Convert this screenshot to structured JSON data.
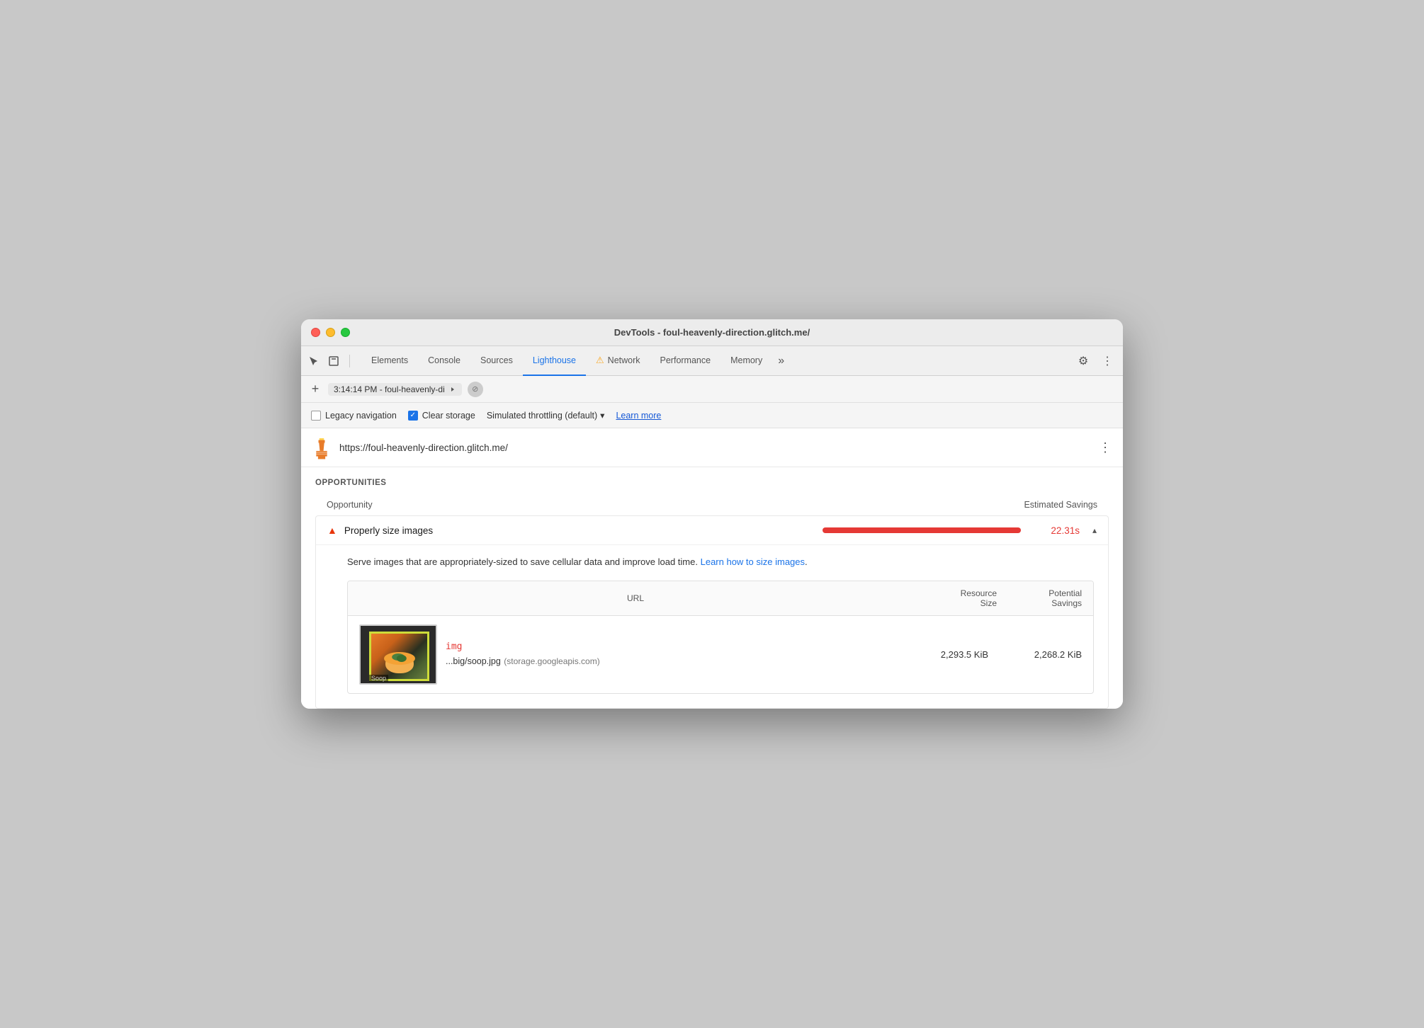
{
  "window": {
    "title": "DevTools - foul-heavenly-direction.glitch.me/"
  },
  "tabs": {
    "items": [
      {
        "id": "elements",
        "label": "Elements",
        "active": false
      },
      {
        "id": "console",
        "label": "Console",
        "active": false
      },
      {
        "id": "sources",
        "label": "Sources",
        "active": false
      },
      {
        "id": "lighthouse",
        "label": "Lighthouse",
        "active": true
      },
      {
        "id": "network",
        "label": "Network",
        "active": false,
        "warning": true
      },
      {
        "id": "performance",
        "label": "Performance",
        "active": false
      },
      {
        "id": "memory",
        "label": "Memory",
        "active": false
      }
    ],
    "more_label": "»"
  },
  "location_bar": {
    "add_label": "+",
    "timestamp": "3:14:14 PM - foul-heavenly-di",
    "stop_icon": "⊘"
  },
  "options_bar": {
    "legacy_nav_label": "Legacy navigation",
    "clear_storage_label": "Clear storage",
    "throttling_label": "Simulated throttling (default)",
    "learn_more_label": "Learn more"
  },
  "site": {
    "url": "https://foul-heavenly-direction.glitch.me/",
    "menu_icon": "⋮"
  },
  "opportunities": {
    "section_title": "OPPORTUNITIES",
    "col_opportunity": "Opportunity",
    "col_savings": "Estimated Savings",
    "items": [
      {
        "id": "properly-size-images",
        "title": "Properly size images",
        "severity": "warning",
        "estimated_savings": "22.31s",
        "bar_color": "#e53935",
        "description": "Serve images that are appropriately-sized to save cellular data and improve load time.",
        "learn_link_text": "Learn how to size images",
        "detail_col_url": "URL",
        "detail_col_resource": "Resource Size",
        "detail_col_savings": "Potential Savings",
        "detail_rows": [
          {
            "img_tag": "img",
            "url_short": "...big/soop.jpg",
            "url_domain": "(storage.googleapis.com)",
            "resource_size": "2,293.5 KiB",
            "potential_savings": "2,268.2 KiB",
            "thumbnail_label": "Soop"
          }
        ]
      }
    ]
  },
  "icons": {
    "cursor": "↖",
    "inspector": "□",
    "settings": "⚙",
    "more_vert": "⋮",
    "chevron_down": "▾",
    "chevron_up": "▴"
  }
}
